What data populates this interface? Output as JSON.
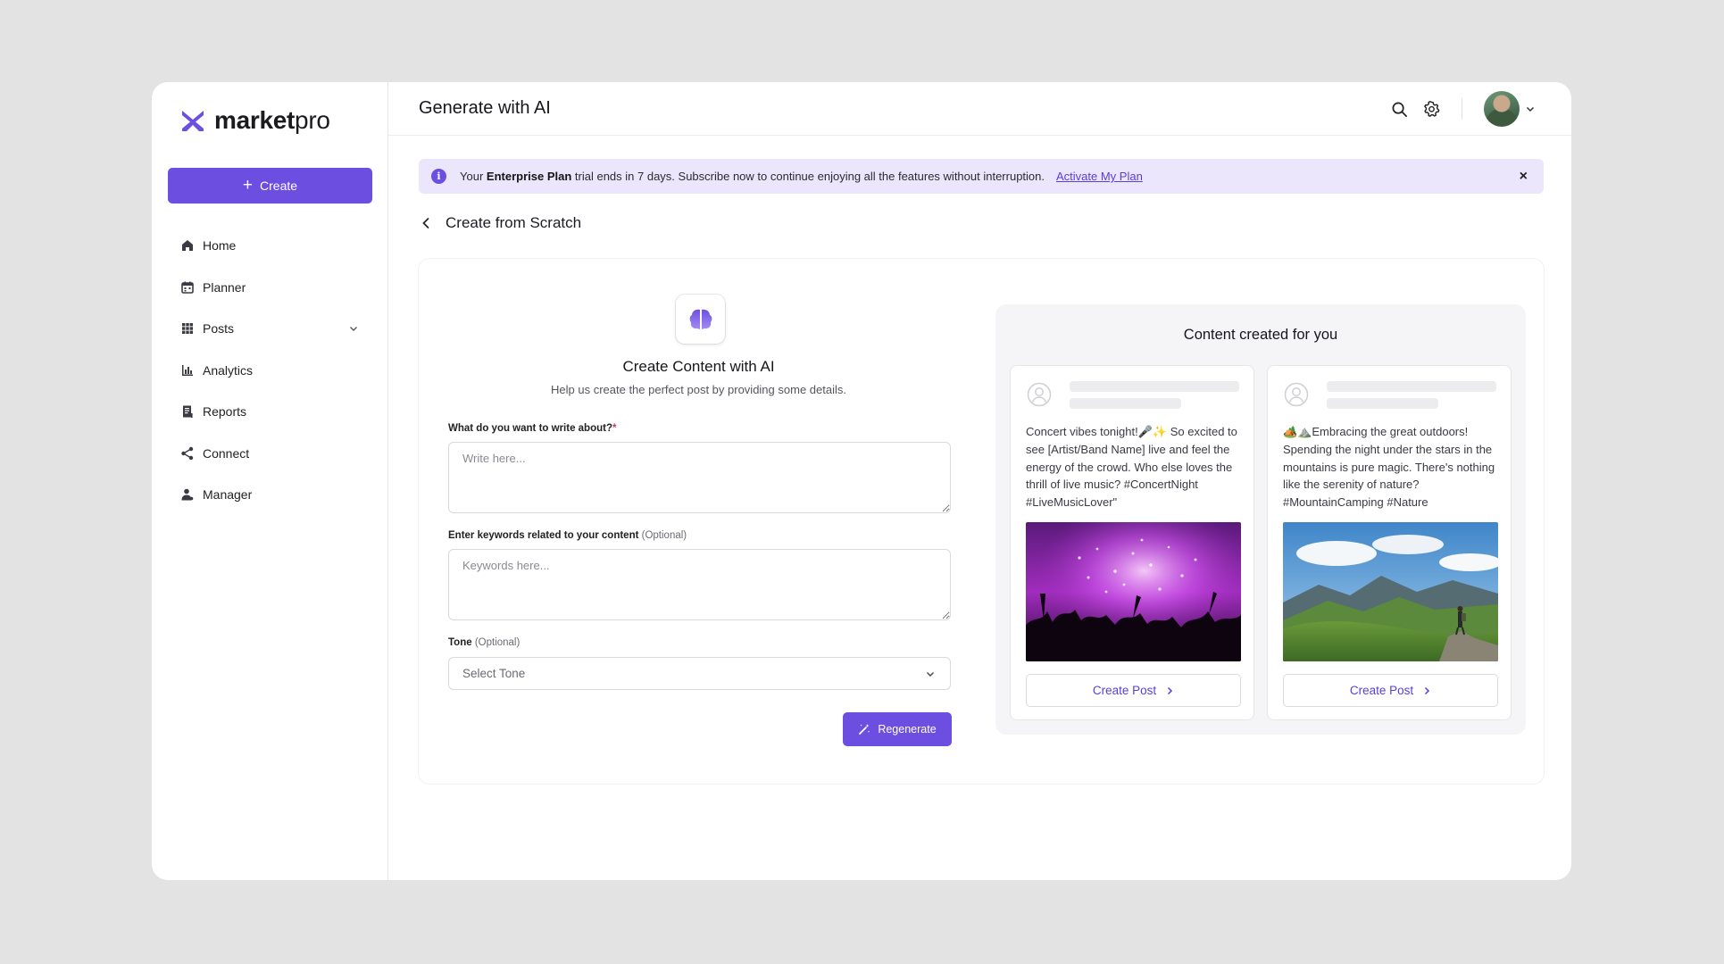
{
  "brand": {
    "name_bold": "market",
    "name_rest": "pro",
    "accent": "#6c4fe0"
  },
  "sidebar": {
    "create_label": "Create",
    "items": [
      {
        "label": "Home",
        "icon": "home-icon"
      },
      {
        "label": "Planner",
        "icon": "calendar-icon"
      },
      {
        "label": "Posts",
        "icon": "grid-icon"
      },
      {
        "label": "Analytics",
        "icon": "bar-chart-icon"
      },
      {
        "label": "Reports",
        "icon": "document-icon"
      },
      {
        "label": "Connect",
        "icon": "share-icon"
      },
      {
        "label": "Manager",
        "icon": "user-icon"
      }
    ]
  },
  "header": {
    "title": "Generate with AI"
  },
  "banner": {
    "prefix": "Your",
    "plan": "Enterprise Plan",
    "message": "trial ends in 7 days. Subscribe now to continue enjoying all the features without interruption.",
    "link": "Activate My Plan",
    "close": "×"
  },
  "breadcrumb": {
    "label": "Create from Scratch"
  },
  "form": {
    "title": "Create Content with AI",
    "subtitle": "Help us create the perfect post by providing some details.",
    "topic_label": "What do you want to write about?",
    "topic_required": "*",
    "topic_placeholder": "Write here...",
    "keywords_label": "Enter keywords related to your content",
    "keywords_optional": "(Optional)",
    "keywords_placeholder": "Keywords here...",
    "tone_label": "Tone",
    "tone_optional": "(Optional)",
    "tone_value": "Select Tone",
    "regenerate": "Regenerate"
  },
  "results": {
    "title": "Content created for you",
    "posts": [
      {
        "text": "Concert vibes tonight!🎤✨ So excited to see [Artist/Band Name] live and feel the energy of the crowd. Who else loves the thrill of live music? #ConcertNight #LiveMusicLover\"",
        "image": "concert-crowd-image",
        "button": "Create Post"
      },
      {
        "text": "🏕️⛰️Embracing the great outdoors! Spending the night under the stars in the mountains is pure magic. There's nothing like the serenity of nature? #MountainCamping #Nature",
        "image": "mountain-hiker-image",
        "button": "Create Post"
      }
    ]
  }
}
